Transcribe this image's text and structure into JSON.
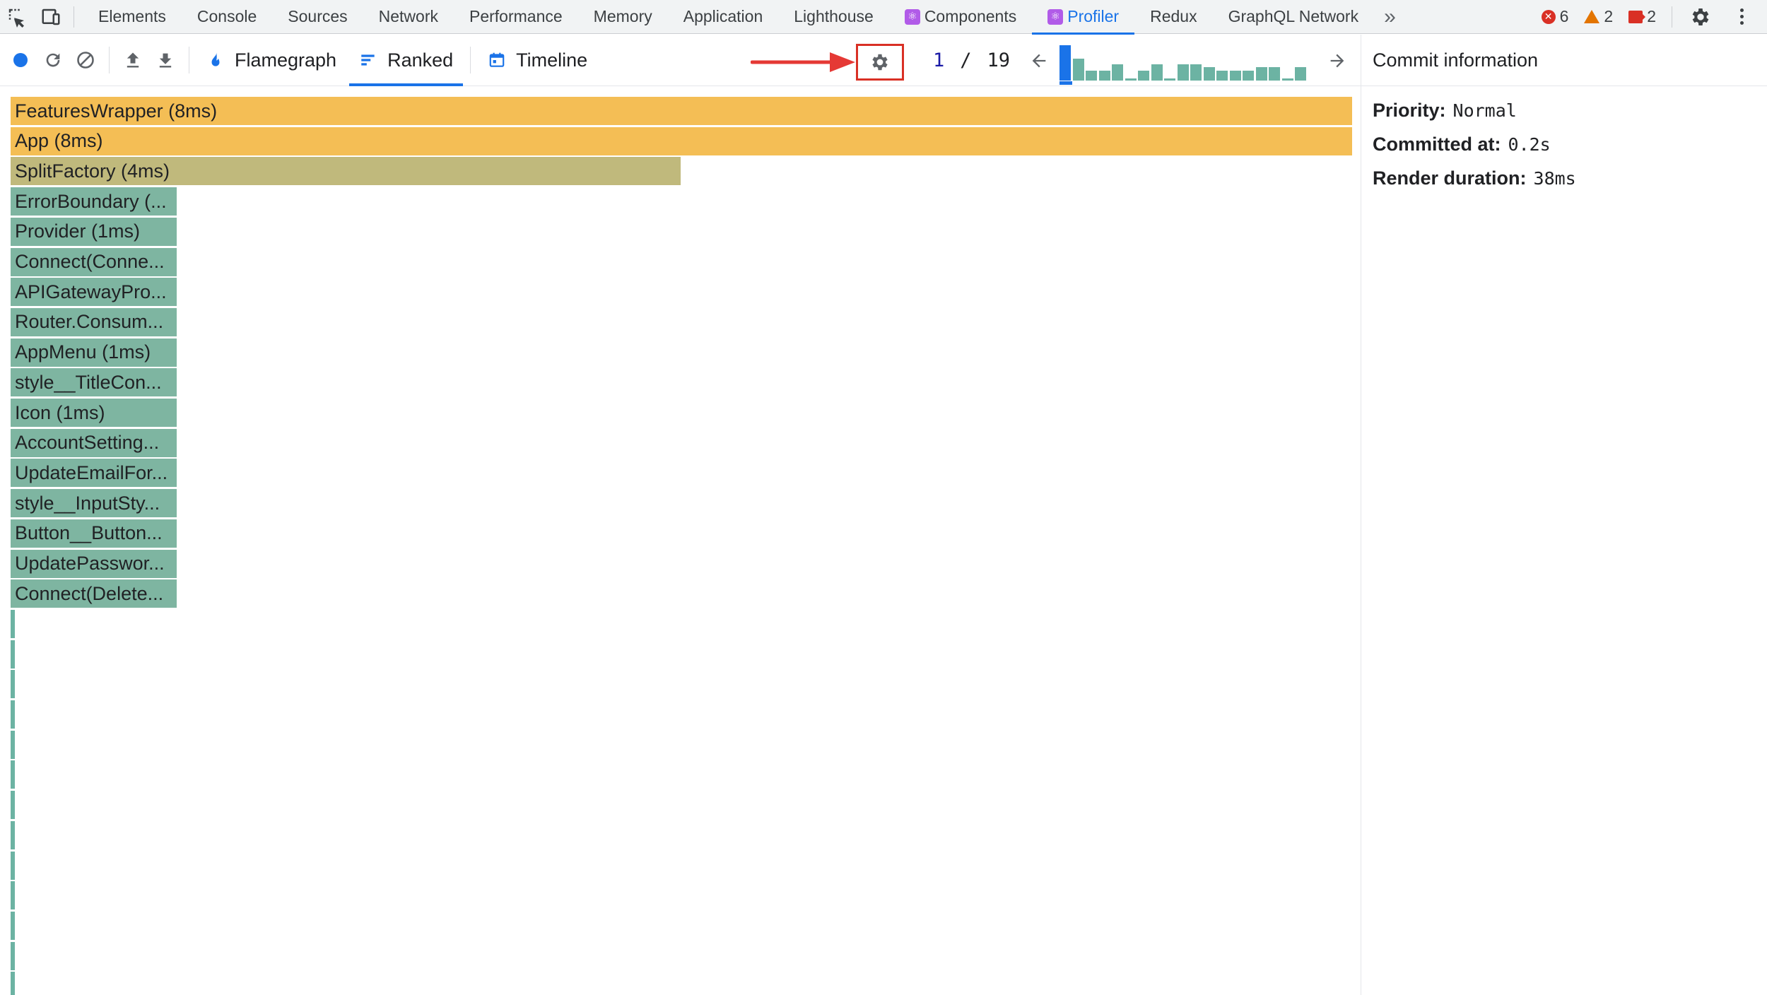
{
  "devtools": {
    "tabs": [
      {
        "label": "Elements",
        "active": false,
        "react": false
      },
      {
        "label": "Console",
        "active": false,
        "react": false
      },
      {
        "label": "Sources",
        "active": false,
        "react": false
      },
      {
        "label": "Network",
        "active": false,
        "react": false
      },
      {
        "label": "Performance",
        "active": false,
        "react": false
      },
      {
        "label": "Memory",
        "active": false,
        "react": false
      },
      {
        "label": "Application",
        "active": false,
        "react": false
      },
      {
        "label": "Lighthouse",
        "active": false,
        "react": false
      },
      {
        "label": "Components",
        "active": false,
        "react": true
      },
      {
        "label": "Profiler",
        "active": true,
        "react": true
      },
      {
        "label": "Redux",
        "active": false,
        "react": false
      },
      {
        "label": "GraphQL Network",
        "active": false,
        "react": false
      }
    ],
    "more_tabs": "»",
    "errors": "6",
    "warnings": "2",
    "issues": "2"
  },
  "toolbar": {
    "views": [
      {
        "label": "Flamegraph",
        "icon": "flame-icon",
        "active": false
      },
      {
        "label": "Ranked",
        "icon": "ranked-icon",
        "active": true
      },
      {
        "label": "Timeline",
        "icon": "calendar-icon",
        "active": false
      }
    ],
    "commit_current": "1",
    "commit_separator": "/",
    "commit_total": "19"
  },
  "commit_bars": [
    {
      "h": 1.0,
      "selected": true
    },
    {
      "h": 0.62,
      "selected": false
    },
    {
      "h": 0.28,
      "selected": false
    },
    {
      "h": 0.28,
      "selected": false
    },
    {
      "h": 0.45,
      "selected": false
    },
    {
      "h": 0.05,
      "selected": false
    },
    {
      "h": 0.28,
      "selected": false
    },
    {
      "h": 0.45,
      "selected": false
    },
    {
      "h": 0.05,
      "selected": false
    },
    {
      "h": 0.45,
      "selected": false
    },
    {
      "h": 0.45,
      "selected": false
    },
    {
      "h": 0.38,
      "selected": false
    },
    {
      "h": 0.28,
      "selected": false
    },
    {
      "h": 0.28,
      "selected": false
    },
    {
      "h": 0.28,
      "selected": false
    },
    {
      "h": 0.38,
      "selected": false
    },
    {
      "h": 0.38,
      "selected": false
    },
    {
      "h": 0.05,
      "selected": false
    },
    {
      "h": 0.38,
      "selected": false
    }
  ],
  "commit_info": {
    "title": "Commit information",
    "priority_label": "Priority",
    "priority_value": "Normal",
    "committed_label": "Committed at",
    "committed_value": "0.2s",
    "duration_label": "Render duration",
    "duration_value": "38ms"
  },
  "ranked": {
    "items": [
      {
        "label": "FeaturesWrapper (8ms)",
        "ms": 8,
        "color": "#f4be55"
      },
      {
        "label": "App (8ms)",
        "ms": 8,
        "color": "#f4be55"
      },
      {
        "label": "SplitFactory (4ms)",
        "ms": 4,
        "color": "#c0b97c"
      },
      {
        "label": "ErrorBoundary (...",
        "ms": 1,
        "color": "#7eb5a1"
      },
      {
        "label": "Provider (1ms)",
        "ms": 1,
        "color": "#7eb5a1"
      },
      {
        "label": "Connect(Conne...",
        "ms": 1,
        "color": "#7eb5a1"
      },
      {
        "label": "APIGatewayPro...",
        "ms": 1,
        "color": "#7eb5a1"
      },
      {
        "label": "Router.Consum...",
        "ms": 1,
        "color": "#7eb5a1"
      },
      {
        "label": "AppMenu (1ms)",
        "ms": 1,
        "color": "#7eb5a1"
      },
      {
        "label": "style__TitleCon...",
        "ms": 1,
        "color": "#7eb5a1"
      },
      {
        "label": "Icon (1ms)",
        "ms": 1,
        "color": "#7eb5a1"
      },
      {
        "label": "AccountSetting...",
        "ms": 1,
        "color": "#7eb5a1"
      },
      {
        "label": "UpdateEmailFor...",
        "ms": 1,
        "color": "#7eb5a1"
      },
      {
        "label": "style__InputSty...",
        "ms": 1,
        "color": "#7eb5a1"
      },
      {
        "label": "Button__Button...",
        "ms": 1,
        "color": "#7eb5a1"
      },
      {
        "label": "UpdatePasswor...",
        "ms": 1,
        "color": "#7eb5a1"
      },
      {
        "label": "Connect(Delete...",
        "ms": 1,
        "color": "#7eb5a1"
      }
    ],
    "stub_count": 13,
    "stub_color": "#6cb3a3"
  },
  "colors": {
    "accent": "#1a73e8",
    "annotation": "#d93025",
    "commit_bar": "#6cb3a3"
  }
}
